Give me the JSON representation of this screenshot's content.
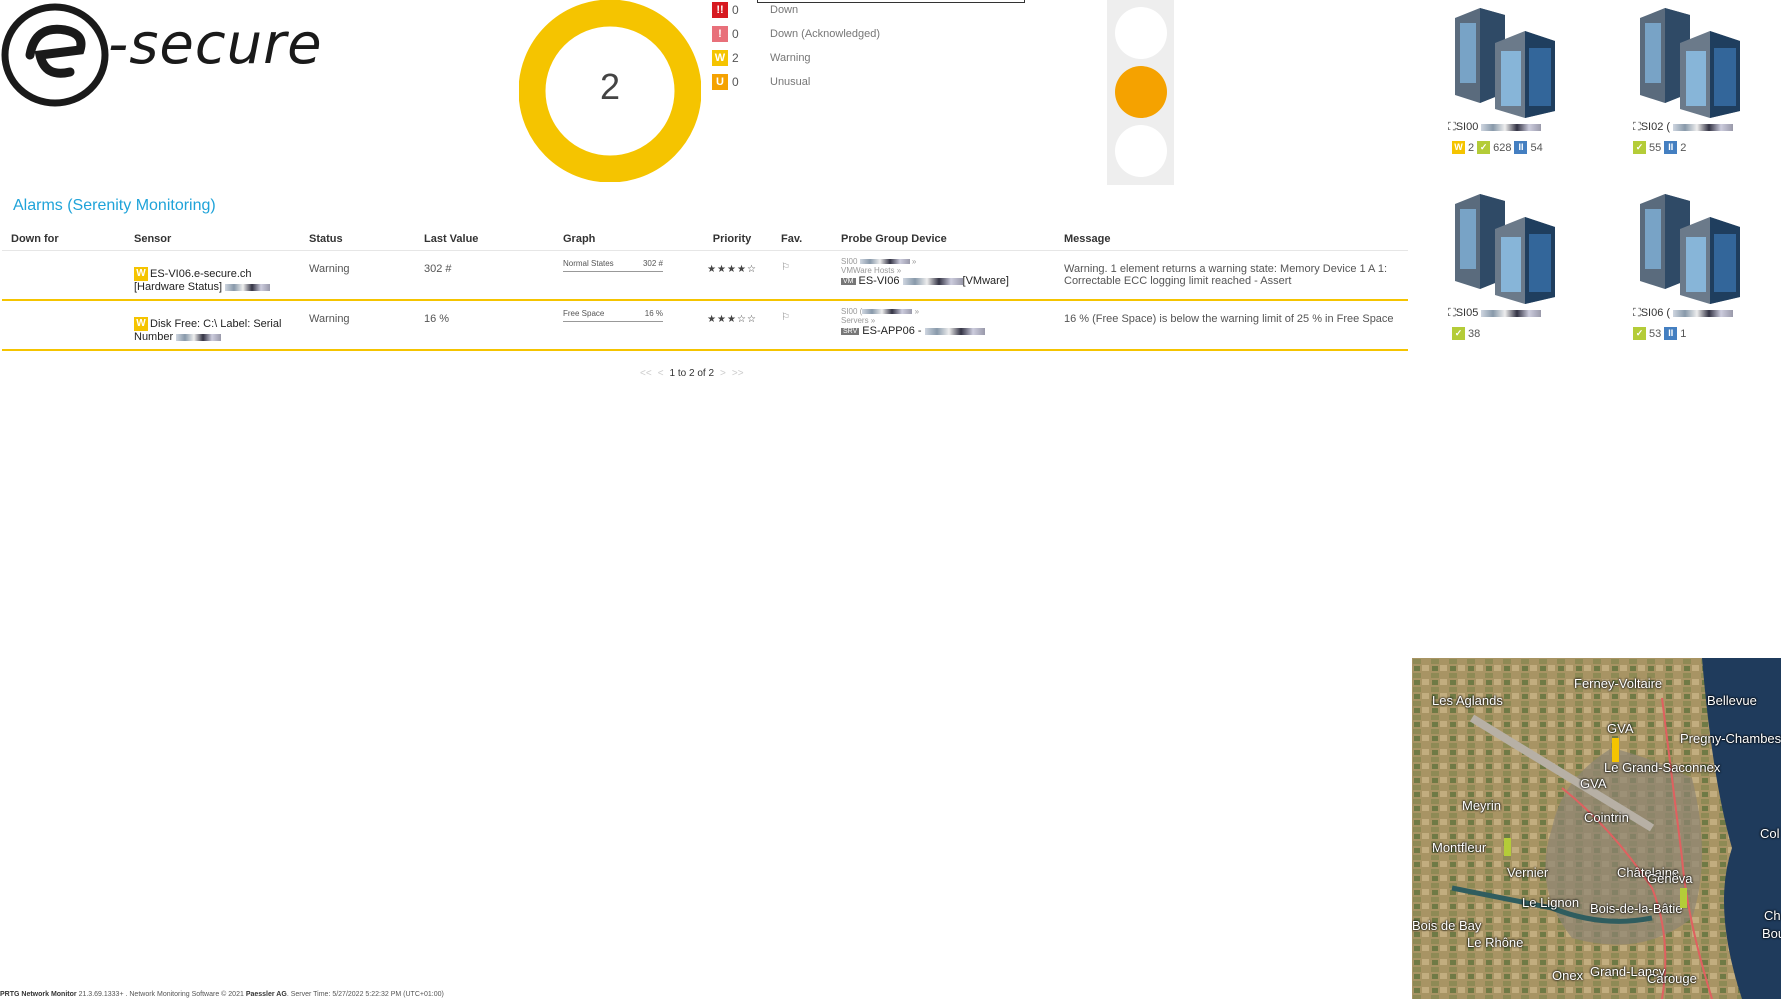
{
  "logo": {
    "text": "-secure"
  },
  "summary": {
    "total": "2",
    "rows": [
      {
        "badge": "!!",
        "color": "#d71920",
        "count": "0",
        "label": "Down"
      },
      {
        "badge": "!",
        "color": "#e8707a",
        "count": "0",
        "label": "Down (Acknowledged)"
      },
      {
        "badge": "W",
        "color": "#f5c400",
        "count": "2",
        "label": "Warning"
      },
      {
        "badge": "U",
        "color": "#f5a200",
        "count": "0",
        "label": "Unusual"
      }
    ]
  },
  "traffic_light": {
    "top": "#ffffff",
    "middle": "#f5a200",
    "bottom": "#ffffff"
  },
  "alarms": {
    "title": "Alarms (Serenity Monitoring)",
    "columns": [
      "Down for",
      "Sensor",
      "Status",
      "Last Value",
      "Graph",
      "Priority",
      "Fav.",
      "Probe Group Device",
      "Message"
    ],
    "rows": [
      {
        "down_for": "",
        "sensor_badge": "W",
        "sensor_line1": "ES-VI06.e-secure.ch",
        "sensor_line2": "[Hardware Status]",
        "status": "Warning",
        "last_value": "302 #",
        "graph_label": "Normal States",
        "graph_value": "302 #",
        "priority": "★★★★☆",
        "probe": "SI00 ",
        "group": "VMWare Hosts »",
        "device_tag": "VM",
        "device": "ES-VI06",
        "device_suffix": "[VMware]",
        "message": "Warning. 1 element returns a warning state: Memory Device 1 A 1: Correctable ECC logging limit reached - Assert"
      },
      {
        "down_for": "",
        "sensor_badge": "W",
        "sensor_line1": "Disk Free: C:\\ Label: Serial",
        "sensor_line2": "Number",
        "status": "Warning",
        "last_value": "16 %",
        "graph_label": "Free Space",
        "graph_value": "16 %",
        "priority": "★★★☆☆",
        "probe": "SI00 (",
        "group": "Servers »",
        "device_tag": "SRV",
        "device": "ES-APP06 -",
        "device_suffix": "",
        "message": "16 % (Free Space) is below the warning limit of 25 % in Free Space"
      }
    ],
    "pager": {
      "first": "<<",
      "prev": "<",
      "text": "1 to 2 of 2",
      "next": ">",
      "last": ">>"
    }
  },
  "servers": [
    {
      "name": "SI00",
      "stats": [
        {
          "type": "w",
          "badge": "W",
          "count": "2"
        },
        {
          "type": "ok",
          "badge": "✓",
          "count": "628"
        },
        {
          "type": "p",
          "badge": "II",
          "count": "54"
        }
      ]
    },
    {
      "name": "SI02 (",
      "stats": [
        {
          "type": "ok",
          "badge": "✓",
          "count": "55"
        },
        {
          "type": "p",
          "badge": "II",
          "count": "2"
        }
      ]
    },
    {
      "name": "SI05",
      "stats": [
        {
          "type": "ok",
          "badge": "✓",
          "count": "38"
        }
      ]
    },
    {
      "name": "SI06 (",
      "stats": [
        {
          "type": "ok",
          "badge": "✓",
          "count": "53"
        },
        {
          "type": "p",
          "badge": "II",
          "count": "1"
        }
      ]
    }
  ],
  "map": {
    "labels": [
      "Les Aglands",
      "Ferney-Voltaire",
      "Bellevue",
      "GVA",
      "Pregny-Chambesy",
      "Le Grand-Saconnex",
      "GVA",
      "Meyrin",
      "Cointrin",
      "Montfleur",
      "Vernier",
      "Châtelaine",
      "Genèva",
      "Le Lignon",
      "Bois-de-la-Bâtie",
      "Le Rhône",
      "Onex",
      "Grand-Lancy",
      "Carouge",
      "Col",
      "Bois de Bay",
      "Ch",
      "Bou"
    ]
  },
  "footer": {
    "product": "PRTG Network Monitor",
    "version": " 21.3.69.1333+ . Network Monitoring Software © 2021 ",
    "company": "Paessler AG",
    "server_time": ". Server Time: 5/27/2022 5:22:32 PM (UTC+01:00)"
  }
}
